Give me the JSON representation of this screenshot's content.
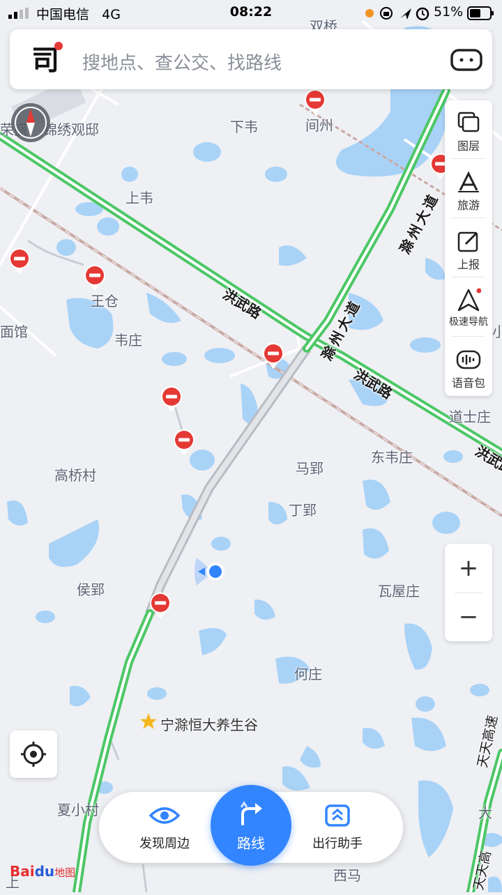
{
  "status_bar": {
    "carrier": "中国电信",
    "network": "4G",
    "time": "08:22",
    "battery_percent": "51%"
  },
  "search": {
    "placeholder": "搜地点、查公交、找路线",
    "logo_char": "司"
  },
  "toolbar": {
    "items": [
      {
        "label": "图层",
        "icon": "layers-icon"
      },
      {
        "label": "旅游",
        "icon": "travel-icon"
      },
      {
        "label": "上报",
        "icon": "report-icon"
      },
      {
        "label": "极速导航",
        "icon": "navigation-icon"
      },
      {
        "label": "语音包",
        "icon": "voice-pack-icon"
      }
    ]
  },
  "zoom": {
    "plus": "+",
    "minus": "−"
  },
  "places": {
    "shuangqiao": "双桥",
    "xiawei": "下韦",
    "jianzhou": "间州",
    "rongsheng": "荣盛",
    "jinxiu": "锦绣观邸",
    "shangwei": "上韦",
    "wangcang": "王仓",
    "miancuan": "面馆",
    "weizhuang": "韦庄",
    "daoshizhuang": "道士庄",
    "dongweizhuang": "东韦庄",
    "mayun": "马郢",
    "gaoqiaocun": "高桥村",
    "dingying": "丁郢",
    "houying": "侯郢",
    "wawuzhuang": "瓦屋庄",
    "hezhuang": "何庄",
    "poi_star": "宁滁恒大养生谷",
    "xiaxiaocun": "夏小村",
    "xima": "西马",
    "shang": "上",
    "xiao": "小",
    "da": "大"
  },
  "roads": {
    "hongwu_1": "洪武路",
    "hongwu_2": "洪武路",
    "hongwu_3": "洪武路",
    "chuzhou_1": "滁州大道",
    "chuzhou_2": "滁州大道",
    "tiantian_1": "天天高速",
    "tiantian_2": "天天高",
    "tiantian_3": "大侯"
  },
  "bottom_nav": {
    "discover": "发现周边",
    "route": "路线",
    "assistant": "出行助手"
  },
  "brand": {
    "bai": "Bai",
    "du": "du",
    "map": "地图"
  },
  "colors": {
    "water": "#a9d2f7",
    "land": "#eef0f4",
    "road_green": "#4cc766",
    "accent_blue": "#3385ff",
    "closure_red": "#e53935"
  }
}
